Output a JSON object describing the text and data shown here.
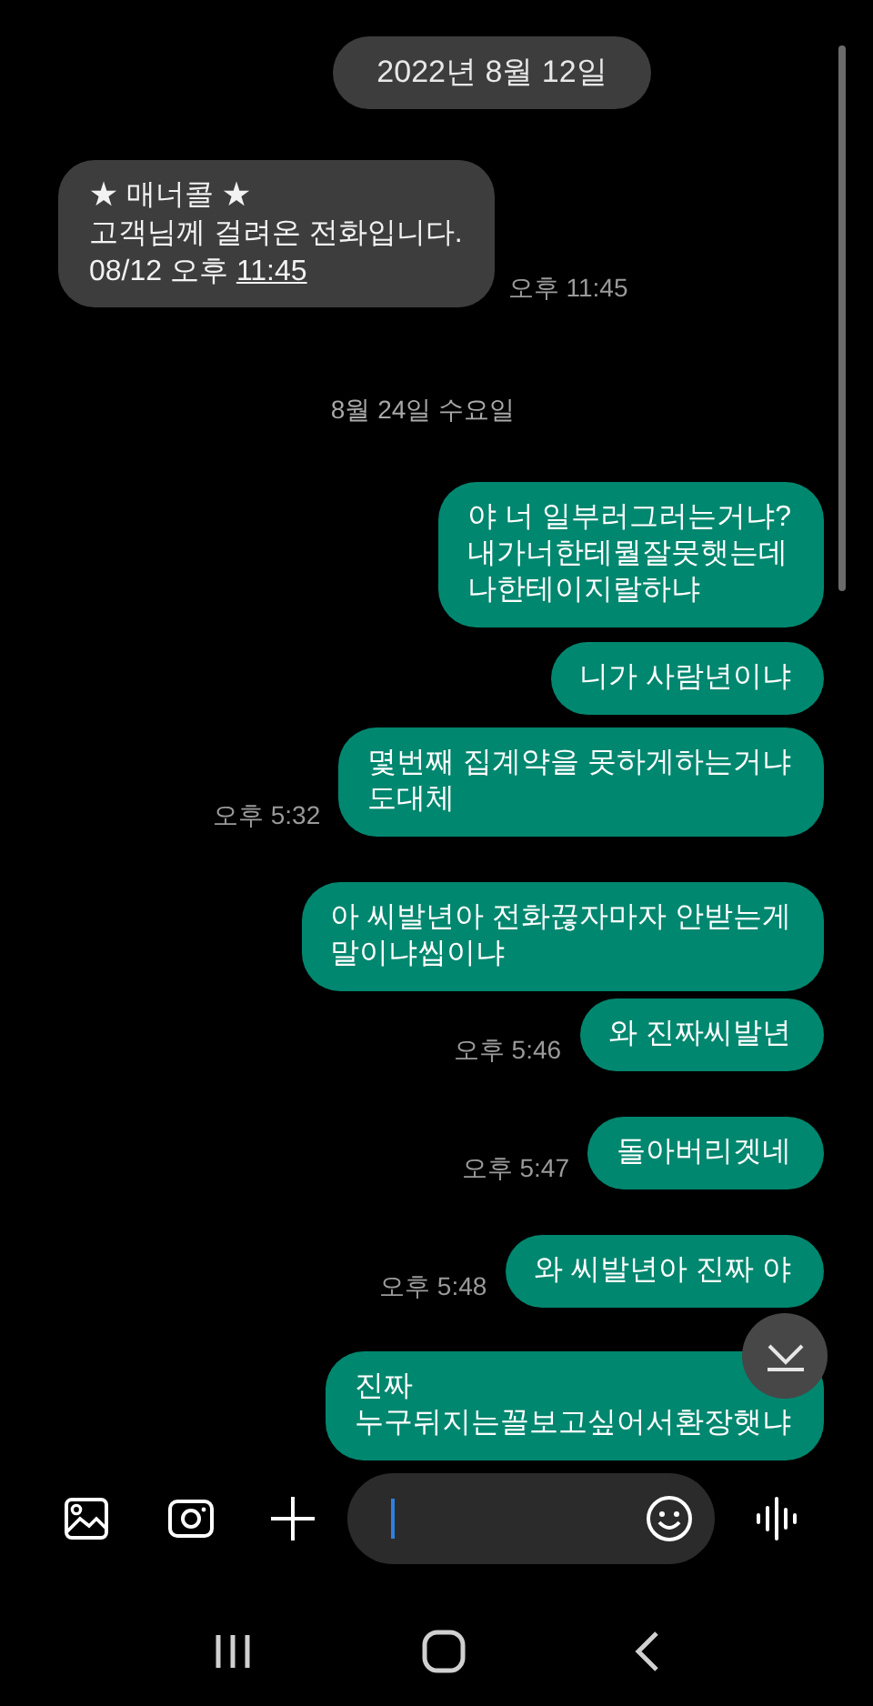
{
  "date_chip": "2022년 8월 12일",
  "messages": [
    {
      "kind": "incoming",
      "lines": [
        "★ 매너콜 ★",
        "고객님께 걸려온 전화입니다."
      ],
      "prefix": "08/12 오후 ",
      "link": "11:45",
      "time": "오후 11:45"
    },
    {
      "kind": "divider",
      "text": "8월 24일 수요일"
    },
    {
      "kind": "outgoing",
      "lines": [
        "야 너 일부러그러는거냐?",
        "내가너한테뭘잘못햇는데",
        "나한테이지랄하냐"
      ]
    },
    {
      "kind": "outgoing",
      "lines": [
        "니가 사람년이냐"
      ]
    },
    {
      "kind": "outgoing",
      "lines": [
        "몇번째 집계약을 못하게하는거냐",
        "도대체"
      ],
      "time": "오후 5:32"
    },
    {
      "kind": "outgoing",
      "lines": [
        "아 씨발년아 전화끊자마자 안받는게",
        "말이냐씹이냐"
      ]
    },
    {
      "kind": "outgoing",
      "lines": [
        "와 진짜씨발년"
      ],
      "time": "오후 5:46"
    },
    {
      "kind": "outgoing",
      "lines": [
        "돌아버리겟네"
      ],
      "time": "오후 5:47"
    },
    {
      "kind": "outgoing",
      "lines": [
        "와 씨발년아 진짜 야"
      ],
      "time": "오후 5:48"
    },
    {
      "kind": "outgoing",
      "lines": [
        "진짜",
        "누구뒤지는꼴보고싶어서환장햇냐"
      ]
    }
  ]
}
